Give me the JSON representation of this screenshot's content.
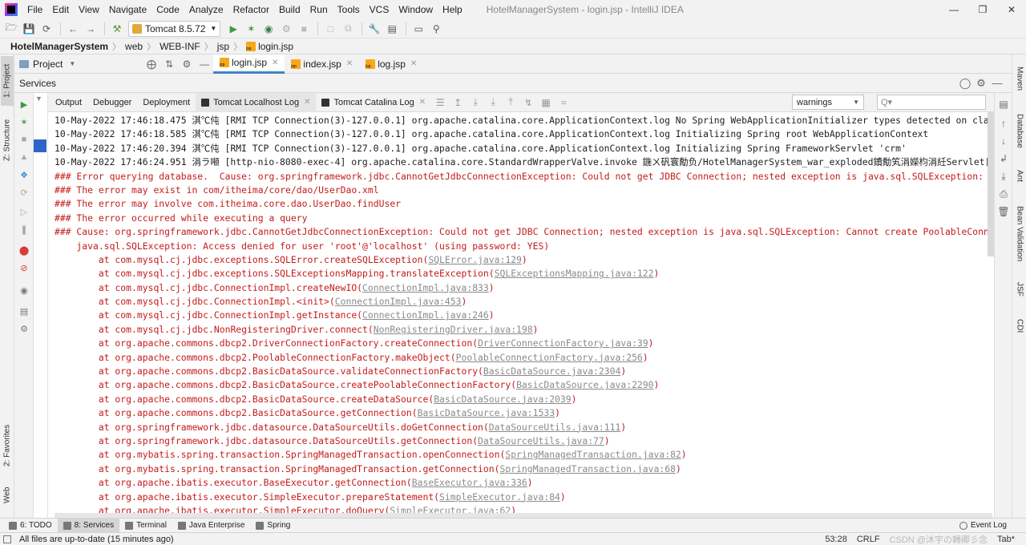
{
  "menu": {
    "items": [
      "File",
      "Edit",
      "View",
      "Navigate",
      "Code",
      "Analyze",
      "Refactor",
      "Build",
      "Run",
      "Tools",
      "VCS",
      "Window",
      "Help"
    ],
    "window_title": "HotelManagerSystem - login.jsp - IntelliJ IDEA"
  },
  "toolbar": {
    "run_config": "Tomcat 8.5.72"
  },
  "breadcrumb": {
    "items": [
      "HotelManagerSystem",
      "web",
      "WEB-INF",
      "jsp",
      "login.jsp"
    ]
  },
  "left_strip": {
    "project": "1: Project",
    "structure": "Z: Structure",
    "favorites": "2: Favorites",
    "web": "Web"
  },
  "right_strip": {
    "maven": "Maven",
    "database": "Database",
    "ant": "Ant",
    "bean_validation": "Bean Validation",
    "jsf": "JSF",
    "cdi": "CDI"
  },
  "editor": {
    "project_label": "Project",
    "tabs": [
      {
        "label": "login.jsp",
        "active": true
      },
      {
        "label": "index.jsp",
        "active": false
      },
      {
        "label": "log.jsp",
        "active": false
      }
    ]
  },
  "services": {
    "title": "Services"
  },
  "console_tabs": {
    "tabs": [
      {
        "label": "Output",
        "closable": false,
        "active": false
      },
      {
        "label": "Debugger",
        "closable": false,
        "active": false
      },
      {
        "label": "Deployment",
        "closable": false,
        "active": false
      },
      {
        "label": "Tomcat Localhost Log",
        "closable": true,
        "active": true
      },
      {
        "label": "Tomcat Catalina Log",
        "closable": true,
        "active": false
      }
    ],
    "log_level": "warnings",
    "search_placeholder": "Q▾"
  },
  "console": {
    "lines": [
      {
        "type": "info",
        "text": "10-May-2022 17:46:18.475 淇℃伅 [RMI TCP Connection(3)-127.0.0.1] org.apache.catalina.core.ApplicationContext.log No Spring WebApplicationInitializer types detected on classpath"
      },
      {
        "type": "info",
        "text": "10-May-2022 17:46:18.585 淇℃伅 [RMI TCP Connection(3)-127.0.0.1] org.apache.catalina.core.ApplicationContext.log Initializing Spring root WebApplicationContext"
      },
      {
        "type": "info",
        "text": "10-May-2022 17:46:20.394 淇℃伅 [RMI TCP Connection(3)-127.0.0.1] org.apache.catalina.core.ApplicationContext.log Initializing Spring FrameworkServlet 'crm'"
      },
      {
        "type": "info",
        "text": "10-May-2022 17:46:24.951 涓ラ噸 [http-nio-8080-exec-4] org.apache.catalina.core.StandardWrapperValve.invoke 鍦ㄨ矾寰勪负/HotelManagerSystem_war_exploded鐨勪笂涓嬫枃涓紝Servlet[crm]鐨"
      },
      {
        "type": "err",
        "text": "### Error querying database.  Cause: org.springframework.jdbc.CannotGetJdbcConnectionException: Could not get JDBC Connection; nested exception is java.sql.SQLException: Cannot"
      },
      {
        "type": "err",
        "text": "### The error may exist in com/itheima/core/dao/UserDao.xml"
      },
      {
        "type": "err",
        "text": "### The error may involve com.itheima.core.dao.UserDao.findUser"
      },
      {
        "type": "err",
        "text": "### The error occurred while executing a query"
      },
      {
        "type": "err",
        "text": "### Cause: org.springframework.jdbc.CannotGetJdbcConnectionException: Could not get JDBC Connection; nested exception is java.sql.SQLException: Cannot create PoolableConnection"
      },
      {
        "type": "err",
        "text": "    java.sql.SQLException: Access denied for user 'root'@'localhost' (using password: YES)"
      },
      {
        "type": "err",
        "text": "        at com.mysql.cj.jdbc.exceptions.SQLError.createSQLException(",
        "link": "SQLError.java:129",
        "tail": ")"
      },
      {
        "type": "err",
        "text": "        at com.mysql.cj.jdbc.exceptions.SQLExceptionsMapping.translateException(",
        "link": "SQLExceptionsMapping.java:122",
        "tail": ")"
      },
      {
        "type": "err",
        "text": "        at com.mysql.cj.jdbc.ConnectionImpl.createNewIO(",
        "link": "ConnectionImpl.java:833",
        "tail": ")"
      },
      {
        "type": "err",
        "text": "        at com.mysql.cj.jdbc.ConnectionImpl.<init>(",
        "link": "ConnectionImpl.java:453",
        "tail": ")"
      },
      {
        "type": "err",
        "text": "        at com.mysql.cj.jdbc.ConnectionImpl.getInstance(",
        "link": "ConnectionImpl.java:246",
        "tail": ")"
      },
      {
        "type": "err",
        "text": "        at com.mysql.cj.jdbc.NonRegisteringDriver.connect(",
        "link": "NonRegisteringDriver.java:198",
        "tail": ")"
      },
      {
        "type": "err",
        "text": "        at org.apache.commons.dbcp2.DriverConnectionFactory.createConnection(",
        "link": "DriverConnectionFactory.java:39",
        "tail": ")"
      },
      {
        "type": "err",
        "text": "        at org.apache.commons.dbcp2.PoolableConnectionFactory.makeObject(",
        "link": "PoolableConnectionFactory.java:256",
        "tail": ")"
      },
      {
        "type": "err",
        "text": "        at org.apache.commons.dbcp2.BasicDataSource.validateConnectionFactory(",
        "link": "BasicDataSource.java:2304",
        "tail": ")"
      },
      {
        "type": "err",
        "text": "        at org.apache.commons.dbcp2.BasicDataSource.createPoolableConnectionFactory(",
        "link": "BasicDataSource.java:2290",
        "tail": ")"
      },
      {
        "type": "err",
        "text": "        at org.apache.commons.dbcp2.BasicDataSource.createDataSource(",
        "link": "BasicDataSource.java:2039",
        "tail": ")"
      },
      {
        "type": "err",
        "text": "        at org.apache.commons.dbcp2.BasicDataSource.getConnection(",
        "link": "BasicDataSource.java:1533",
        "tail": ")"
      },
      {
        "type": "err",
        "text": "        at org.springframework.jdbc.datasource.DataSourceUtils.doGetConnection(",
        "link": "DataSourceUtils.java:111",
        "tail": ")"
      },
      {
        "type": "err",
        "text": "        at org.springframework.jdbc.datasource.DataSourceUtils.getConnection(",
        "link": "DataSourceUtils.java:77",
        "tail": ")"
      },
      {
        "type": "err",
        "text": "        at org.mybatis.spring.transaction.SpringManagedTransaction.openConnection(",
        "link": "SpringManagedTransaction.java:82",
        "tail": ")"
      },
      {
        "type": "err",
        "text": "        at org.mybatis.spring.transaction.SpringManagedTransaction.getConnection(",
        "link": "SpringManagedTransaction.java:68",
        "tail": ")"
      },
      {
        "type": "err",
        "text": "        at org.apache.ibatis.executor.BaseExecutor.getConnection(",
        "link": "BaseExecutor.java:336",
        "tail": ")"
      },
      {
        "type": "err",
        "text": "        at org.apache.ibatis.executor.SimpleExecutor.prepareStatement(",
        "link": "SimpleExecutor.java:84",
        "tail": ")"
      },
      {
        "type": "err",
        "text": "        at org.apache.ibatis.executor.SimpleExecutor.doQuery(",
        "link": "SimpleExecutor.java:62",
        "tail": ")"
      }
    ]
  },
  "bottom_bar": {
    "items": [
      {
        "label": "6: TODO",
        "active": false
      },
      {
        "label": "8: Services",
        "active": true
      },
      {
        "label": "Terminal",
        "active": false
      },
      {
        "label": "Java Enterprise",
        "active": false
      },
      {
        "label": "Spring",
        "active": false
      }
    ],
    "event_log": "Event Log"
  },
  "status_bar": {
    "message": "All files are up-to-date (15 minutes ago)",
    "position": "53:28",
    "line_sep": "CRLF",
    "watermark": "CSDN @沐宇の轉卿彡念",
    "indent": "Tab*"
  }
}
